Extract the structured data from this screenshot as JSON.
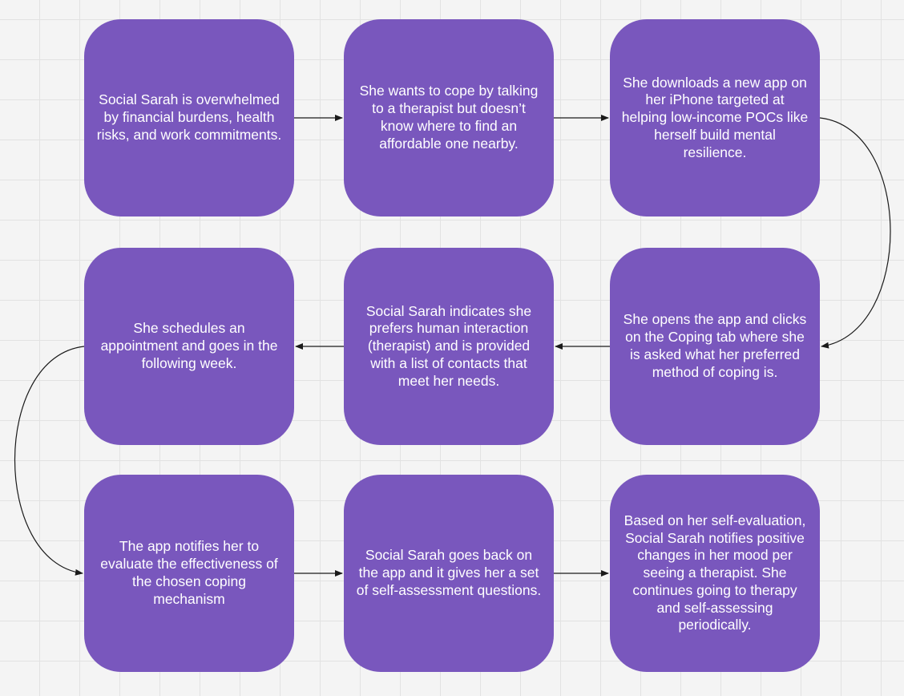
{
  "diagram": {
    "steps": [
      {
        "text": "Social Sarah is overwhelmed by financial burdens, health risks, and work commitments."
      },
      {
        "text": "She wants to cope by talking to a therapist but doesn’t know where to find an affordable one nearby."
      },
      {
        "text": "She downloads a new app on her iPhone targeted at helping low-income POCs like herself build mental resilience."
      },
      {
        "text": "She opens the app and clicks on the Coping tab where she is asked what her preferred method of coping is."
      },
      {
        "text": "Social Sarah indicates she prefers human interaction (therapist) and is provided with a list of contacts that meet her needs."
      },
      {
        "text": "She schedules an appointment and goes in the following week."
      },
      {
        "text": "The app notifies her to evaluate the effectiveness of the chosen coping mechanism"
      },
      {
        "text": "Social Sarah goes back on the app and it gives her a set of self-assessment questions."
      },
      {
        "text": "Based on her self-evaluation, Social Sarah notifies positive changes in her mood per seeing a therapist. She continues going to therapy and self-assessing periodically."
      }
    ],
    "colors": {
      "card": "#7957bd",
      "card_text": "#ffffff",
      "connector": "#1a1a1a",
      "background": "#f4f4f4",
      "grid": "#e2e2e2"
    }
  }
}
